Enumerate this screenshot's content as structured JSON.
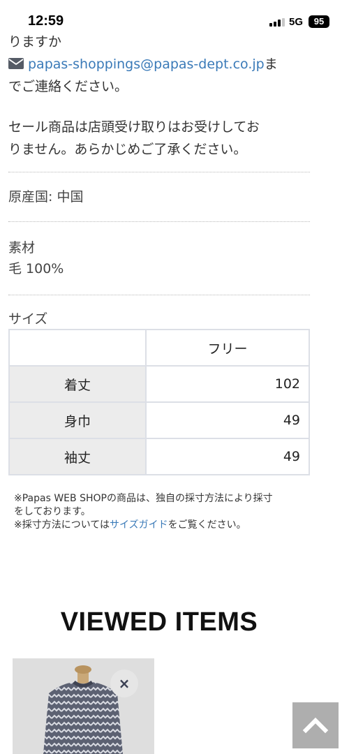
{
  "status_bar": {
    "time": "12:59",
    "network": "5G",
    "battery": "95"
  },
  "description": {
    "truncated_line": "りますか",
    "email": "papas-shoppings@papas-dept.co.jp",
    "email_suffix": "ま",
    "contact_line": "でご連絡ください。",
    "sale_notice_1": "セール商品は店頭受け取りはお受けしてお",
    "sale_notice_2": "りません。あらかじめご了承ください。"
  },
  "origin": {
    "text": "原産国: 中国"
  },
  "material": {
    "label": "素材",
    "value": "毛 100%"
  },
  "size": {
    "label": "サイズ",
    "column_header": "フリー",
    "rows": [
      {
        "name": "着丈",
        "value": "102"
      },
      {
        "name": "身巾",
        "value": "49"
      },
      {
        "name": "袖丈",
        "value": "49"
      }
    ]
  },
  "notes": {
    "line1": "※Papas WEB SHOPの商品は、独自の採寸方法により採寸",
    "line2": "をしております。",
    "line3_prefix": "※採寸方法については",
    "size_guide_link": "サイズガイド",
    "line3_suffix": "をご覧ください。"
  },
  "viewed_items": {
    "title": "VIEWED ITEMS",
    "remove_symbol": "×"
  },
  "colors": {
    "link": "#3a7ab8",
    "table_border": "#dcdfe6",
    "row_header_bg": "#ececec",
    "scroll_top_bg": "#aeaeae"
  },
  "icons": [
    "envelope-icon",
    "close-icon",
    "chevron-up-icon",
    "signal-icon",
    "battery-icon"
  ]
}
